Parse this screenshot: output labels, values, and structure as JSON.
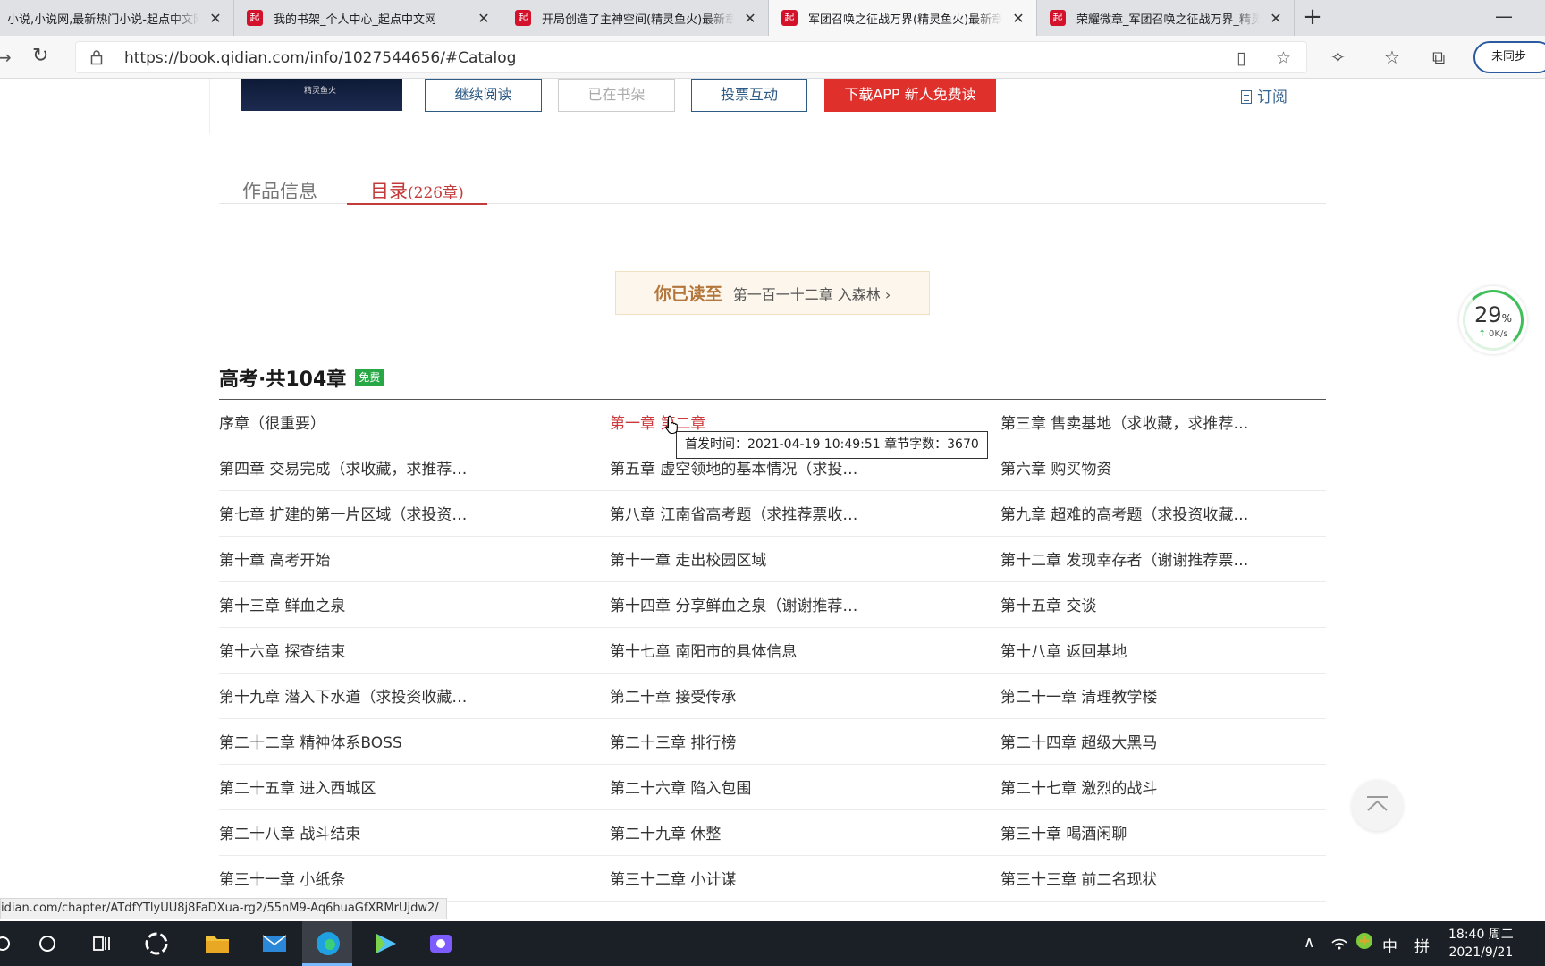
{
  "browser": {
    "tabs": [
      {
        "title": "小说,小说网,最新热门小说-起点中文网",
        "favicon": "起",
        "active": false
      },
      {
        "title": "我的书架_个人中心_起点中文网",
        "favicon": "起",
        "active": false
      },
      {
        "title": "开局创造了主神空间(精灵鱼火)最新章节",
        "favicon": "起",
        "active": false
      },
      {
        "title": "军团召唤之征战万界(精灵鱼火)最新章节",
        "favicon": "起",
        "active": true
      },
      {
        "title": "荣耀微章_军团召唤之征战万界_精灵鱼火",
        "favicon": "起",
        "active": false
      }
    ],
    "new_tab": "+",
    "minimize": "—",
    "url": "https://book.qidian.com/info/1027544656/#Catalog",
    "sync_label": "未同步"
  },
  "book": {
    "cover_text": "精灵鱼火",
    "buttons": {
      "continue_reading": "继续阅读",
      "on_shelf": "已在书架",
      "vote": "投票互动",
      "download": "下载APP  新人免费读"
    },
    "subscribe": "订阅"
  },
  "tabs": {
    "info": "作品信息",
    "catalog": "目录",
    "catalog_count": "(226章)"
  },
  "read_progress": {
    "label": "你已读至",
    "chapter": "第一百一十二章  入森林 ›"
  },
  "volume": {
    "title": "高考·共104章",
    "badge": "免费"
  },
  "chapters": [
    [
      "序章（很重要）",
      "第一章 第二章",
      "第三章  售卖基地（求收藏，求推荐…"
    ],
    [
      "第四章  交易完成（求收藏，求推荐…",
      "第五章  虚空领地的基本情况（求投…",
      "第六章  购买物资"
    ],
    [
      "第七章  扩建的第一片区域（求投资…",
      "第八章  江南省高考题（求推荐票收…",
      "第九章  超难的高考题（求投资收藏…"
    ],
    [
      "第十章  高考开始",
      "第十一章  走出校园区域",
      "第十二章  发现幸存者（谢谢推荐票…"
    ],
    [
      "第十三章  鲜血之泉",
      "第十四章  分享鲜血之泉（谢谢推荐…",
      "第十五章  交谈"
    ],
    [
      "第十六章  探查结束",
      "第十七章  南阳市的具体信息",
      "第十八章  返回基地"
    ],
    [
      "第十九章  潜入下水道（求投资收藏…",
      "第二十章  接受传承",
      "第二十一章  清理教学楼"
    ],
    [
      "第二十二章  精神体系BOSS",
      "第二十三章  排行榜",
      "第二十四章  超级大黑马"
    ],
    [
      "第二十五章  进入西城区",
      "第二十六章  陷入包围",
      "第二十七章  激烈的战斗"
    ],
    [
      "第二十八章  战斗结束",
      "第二十九章  休整",
      "第三十章  喝酒闲聊"
    ],
    [
      "第三十一章  小纸条",
      "第三十二章  小计谋",
      "第三十三章  前二名现状"
    ]
  ],
  "tooltip": "首发时间：2021-04-19 10:49:51 章节字数：3670",
  "speed_widget": {
    "percent": "29",
    "percent_sign": "%",
    "rate": "0K/s"
  },
  "status_url": "idian.com/chapter/ATdfYTlyUU8j8FaDXua-rg2/55nM9-Aq6huaGfXRMrUjdw2/",
  "taskbar": {
    "ime": "中",
    "ime2": "拼",
    "time": "18:40 周二",
    "date": "2021/9/21"
  }
}
